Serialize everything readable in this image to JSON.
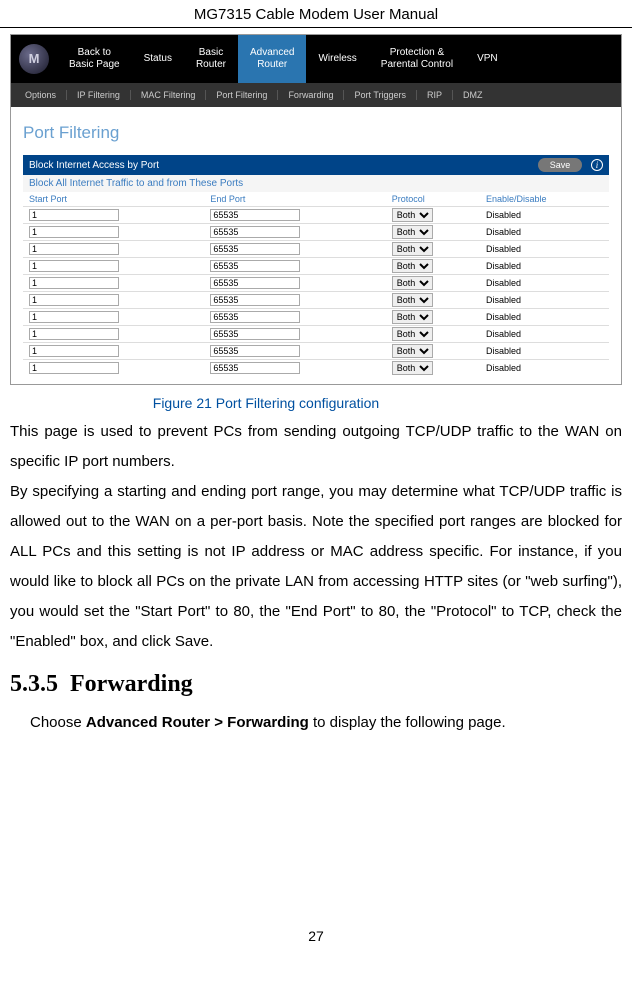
{
  "header": "MG7315 Cable Modem User Manual",
  "nav_main": [
    {
      "line1": "Back to",
      "line2": "Basic Page"
    },
    {
      "line1": "Status",
      "line2": ""
    },
    {
      "line1": "Basic",
      "line2": "Router"
    },
    {
      "line1": "Advanced",
      "line2": "Router"
    },
    {
      "line1": "Wireless",
      "line2": ""
    },
    {
      "line1": "Protection &",
      "line2": "Parental Control"
    },
    {
      "line1": "VPN",
      "line2": ""
    }
  ],
  "nav_sub": [
    "Options",
    "IP Filtering",
    "MAC Filtering",
    "Port Filtering",
    "Forwarding",
    "Port Triggers",
    "RIP",
    "DMZ"
  ],
  "screen_title": "Port Filtering",
  "block_title": "Block Internet Access by Port",
  "save_label": "Save",
  "sub_block": "Block All Internet Traffic to and from These Ports",
  "columns": {
    "start": "Start Port",
    "end": "End Port",
    "proto": "Protocol",
    "ena": "Enable/Disable"
  },
  "rows": [
    {
      "s": "1",
      "e": "65535",
      "p": "Both",
      "en": "Disabled"
    },
    {
      "s": "1",
      "e": "65535",
      "p": "Both",
      "en": "Disabled"
    },
    {
      "s": "1",
      "e": "65535",
      "p": "Both",
      "en": "Disabled"
    },
    {
      "s": "1",
      "e": "65535",
      "p": "Both",
      "en": "Disabled"
    },
    {
      "s": "1",
      "e": "65535",
      "p": "Both",
      "en": "Disabled"
    },
    {
      "s": "1",
      "e": "65535",
      "p": "Both",
      "en": "Disabled"
    },
    {
      "s": "1",
      "e": "65535",
      "p": "Both",
      "en": "Disabled"
    },
    {
      "s": "1",
      "e": "65535",
      "p": "Both",
      "en": "Disabled"
    },
    {
      "s": "1",
      "e": "65535",
      "p": "Both",
      "en": "Disabled"
    },
    {
      "s": "1",
      "e": "65535",
      "p": "Both",
      "en": "Disabled"
    }
  ],
  "figure_caption": "Figure 21 Port Filtering configuration",
  "para1": "This page is used to prevent PCs from sending outgoing TCP/UDP traffic to the WAN on specific IP port numbers.",
  "para2": "By specifying a starting and ending port range, you may determine what TCP/UDP traffic is allowed out to the WAN on a per-port basis.   Note the specified port ranges are blocked for ALL PCs and this setting is not IP address or MAC address specific. For instance, if you would like to block all PCs on the private LAN from accessing HTTP sites (or \"web surfing\"), you would set the \"Start Port\" to 80, the \"End Port\" to 80, the \"Protocol\" to TCP, check the \"Enabled\" box, and click Save.",
  "section_num": "5.3.5",
  "section_title": "Forwarding",
  "choose_pre": "Choose ",
  "choose_bold": "Advanced Router > Forwarding",
  "choose_post": " to display the following page.",
  "page_num": "27"
}
